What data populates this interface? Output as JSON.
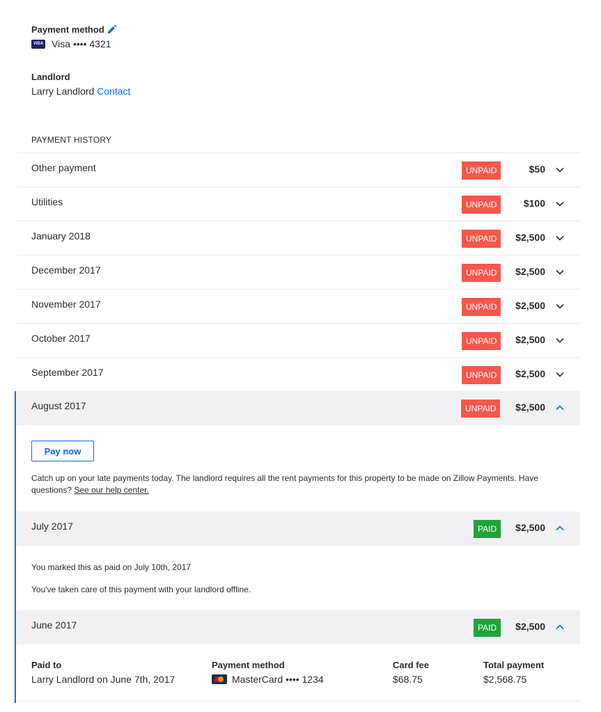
{
  "payment_method": {
    "label": "Payment method",
    "card_brand": "VISA",
    "card_text": "Visa •••• 4321"
  },
  "landlord": {
    "label": "Landlord",
    "name": "Larry Landlord",
    "contact_link": "Contact"
  },
  "history": {
    "title": "PAYMENT HISTORY",
    "collapsed_rows": [
      {
        "label": "Other payment",
        "status": "UNPAID",
        "amount": "$50"
      },
      {
        "label": "Utilities",
        "status": "UNPAID",
        "amount": "$100"
      },
      {
        "label": "January 2018",
        "status": "UNPAID",
        "amount": "$2,500"
      },
      {
        "label": "December 2017",
        "status": "UNPAID",
        "amount": "$2,500"
      },
      {
        "label": "November 2017",
        "status": "UNPAID",
        "amount": "$2,500"
      },
      {
        "label": "October 2017",
        "status": "UNPAID",
        "amount": "$2,500"
      },
      {
        "label": "September 2017",
        "status": "UNPAID",
        "amount": "$2,500"
      }
    ],
    "august": {
      "label": "August 2017",
      "status": "UNPAID",
      "amount": "$2,500",
      "pay_now_label": "Pay now",
      "message": "Catch up on your late payments today. The landlord requires all the rent payments for this property to be made on Zillow Payments. Have questions?",
      "help_link": "See our help center."
    },
    "july": {
      "label": "July 2017",
      "status": "PAID",
      "amount": "$2,500",
      "marked_text": "You marked this as paid on July 10th, 2017",
      "offline_text": "You've taken care of this payment with your landlord offline."
    },
    "june": {
      "label": "June 2017",
      "status": "PAID",
      "amount": "$2,500",
      "paid_to_label": "Paid to",
      "paid_to_value": "Larry Landlord on June 7th, 2017",
      "method_label": "Payment method",
      "method_value": "MasterCard •••• 1234",
      "fee_label": "Card fee",
      "fee_value": "$68.75",
      "total_label": "Total payment",
      "total_value": "$2,568.75"
    }
  },
  "colors": {
    "accent": "#006aff",
    "unpaid": "#f4574c",
    "paid": "#1fa43a",
    "expanded_bg": "#f1f1f4"
  },
  "icons": {
    "edit": "pencil-icon",
    "expand": "chevron-down-icon",
    "collapse": "chevron-up-icon"
  }
}
